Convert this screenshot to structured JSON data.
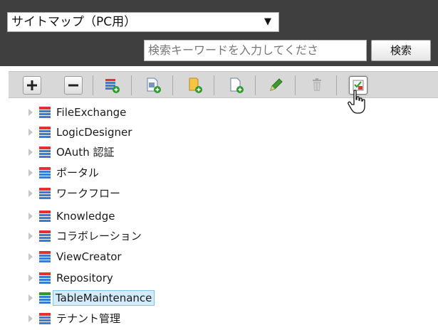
{
  "header": {
    "select_value": "サイトマップ（PC用）",
    "search_placeholder": "検索キーワードを入力してくださ",
    "search_button_label": "検索"
  },
  "toolbar": {
    "buttons": [
      {
        "name": "expand-all-button",
        "icon": "plus-icon"
      },
      {
        "name": "collapse-all-button",
        "icon": "minus-icon"
      },
      {
        "name": "add-category-button",
        "icon": "add-category-icon"
      },
      {
        "name": "add-page-button",
        "icon": "add-page-icon"
      },
      {
        "name": "add-folder-button",
        "icon": "add-folder-icon"
      },
      {
        "name": "add-document-button",
        "icon": "add-document-icon"
      },
      {
        "name": "edit-button",
        "icon": "pencil-icon"
      },
      {
        "name": "delete-button",
        "icon": "trash-icon"
      },
      {
        "name": "checklist-button",
        "icon": "checklist-icon"
      }
    ]
  },
  "tree": {
    "items": [
      {
        "label": "FileExchange"
      },
      {
        "label": "LogicDesigner"
      },
      {
        "label": "OAuth 認証"
      },
      {
        "label": "ポータル"
      },
      {
        "label": "ワークフロー"
      },
      {
        "label": "Knowledge"
      },
      {
        "label": "コラボレーション"
      },
      {
        "label": "ViewCreator"
      },
      {
        "label": "Repository"
      },
      {
        "label": "TableMaintenance",
        "selected": true
      },
      {
        "label": "テナント管理"
      }
    ]
  },
  "colors": {
    "header_bg": "#3f3f3f",
    "toolbar_bg": "#d8d8d8",
    "selected_bg": "#d4ebfb",
    "selected_border": "#7ec4ee"
  }
}
